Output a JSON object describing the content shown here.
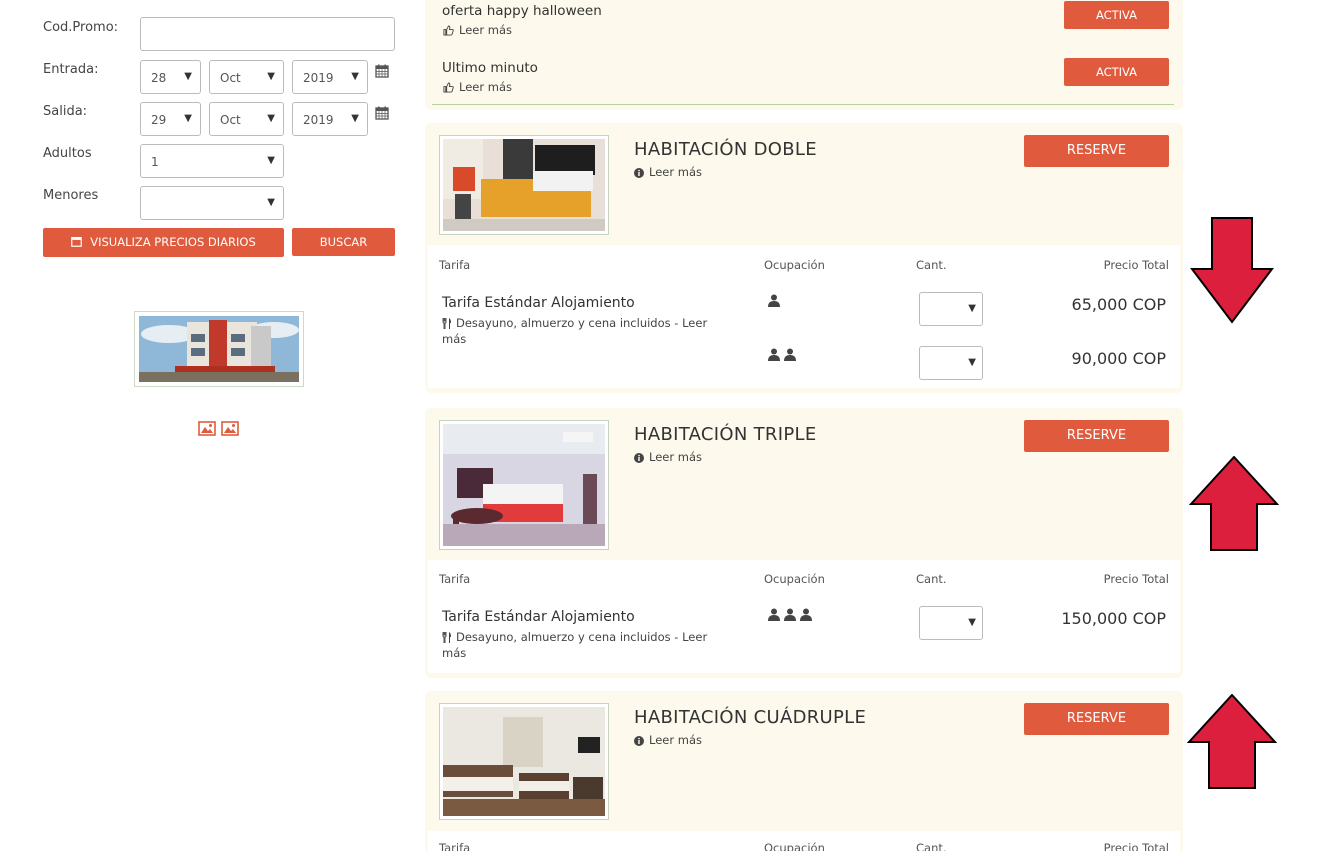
{
  "colors": {
    "accent": "#e05b3e",
    "panel": "#fdf9ec",
    "arrow": "#dc1f3c"
  },
  "booking_form": {
    "promo_label": "Cod.Promo:",
    "promo_value": "",
    "checkin_label": "Entrada:",
    "checkin_day": "28",
    "checkin_month": "Oct",
    "checkin_year": "2019",
    "checkout_label": "Salida:",
    "checkout_day": "29",
    "checkout_month": "Oct",
    "checkout_year": "2019",
    "adults_label": "Adultos",
    "adults_value": "1",
    "children_label": "Menores",
    "children_value": "",
    "daily_prices_button": "VISUALIZA PRECIOS DIARIOS",
    "search_button": "BUSCAR"
  },
  "offers": [
    {
      "title": "oferta happy halloween",
      "more": "Leer más",
      "button": "ACTIVA"
    },
    {
      "title": "Ultimo minuto",
      "more": "Leer más",
      "button": "ACTIVA"
    }
  ],
  "table_headers": {
    "rate": "Tarifa",
    "occupancy": "Ocupación",
    "qty": "Cant.",
    "total": "Precio Total"
  },
  "rooms": [
    {
      "name": "HABITACIÓN DOBLE",
      "more": "Leer más",
      "reserve": "RESERVE",
      "rate_name": "Tarifa Estándar Alojamiento",
      "rate_desc": "Desayuno, almuerzo y cena incluidos - Leer más",
      "rows": [
        {
          "guests": 1,
          "price": "65,000 COP"
        },
        {
          "guests": 2,
          "price": "90,000 COP"
        }
      ]
    },
    {
      "name": "HABITACIÓN TRIPLE",
      "more": "Leer más",
      "reserve": "RESERVE",
      "rate_name": "Tarifa Estándar Alojamiento",
      "rate_desc": "Desayuno, almuerzo y cena incluidos - Leer más",
      "rows": [
        {
          "guests": 3,
          "price": "150,000 COP"
        }
      ]
    },
    {
      "name": "HABITACIÓN CUÁDRUPLE",
      "more": "Leer más",
      "reserve": "RESERVE"
    }
  ]
}
